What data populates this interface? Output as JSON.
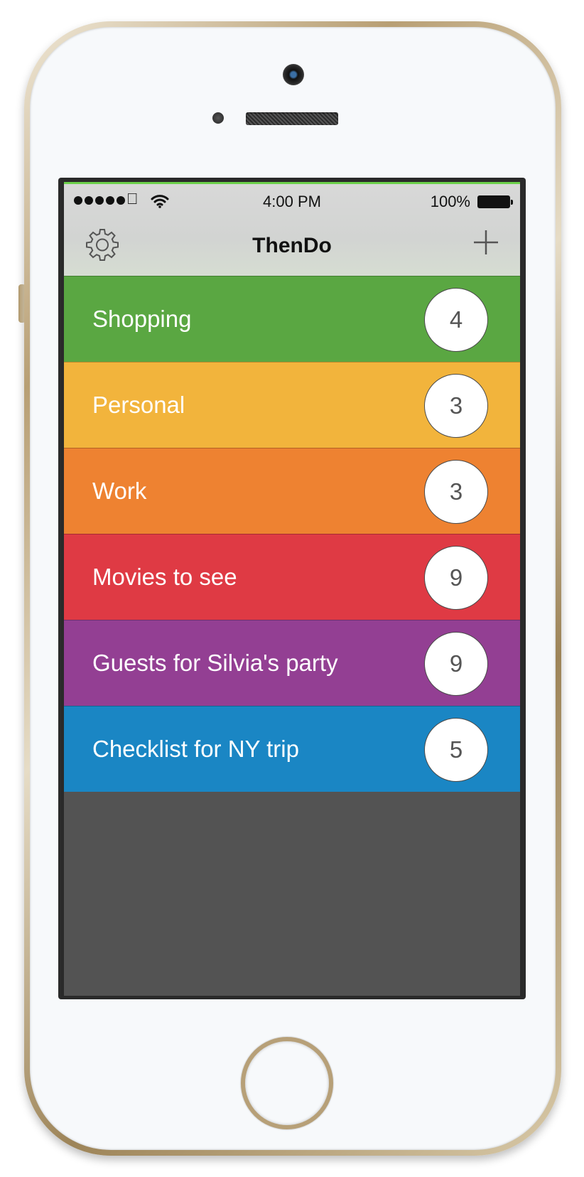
{
  "status_bar": {
    "time": "4:00 PM",
    "battery": "100%",
    "signal_icon": "signal-dots-icon",
    "carrier_icon": "apple-icon",
    "wifi_icon": "wifi-icon",
    "battery_icon": "battery-icon"
  },
  "nav": {
    "title": "ThenDo",
    "left_icon": "gear-icon",
    "right_icon": "plus-icon"
  },
  "lists": [
    {
      "label": "Shopping",
      "count": "4",
      "color": "#5aa742"
    },
    {
      "label": "Personal",
      "count": "3",
      "color": "#f2b43c"
    },
    {
      "label": "Work",
      "count": "3",
      "color": "#ee8231"
    },
    {
      "label": "Movies to see",
      "count": "9",
      "color": "#df3a44"
    },
    {
      "label": "Guests for Silvia's party",
      "count": "9",
      "color": "#933f93"
    },
    {
      "label": "Checklist for NY trip",
      "count": "5",
      "color": "#1a86c4"
    }
  ],
  "colors": {
    "empty_area": "#535353",
    "accent_line": "#6cd04a"
  }
}
